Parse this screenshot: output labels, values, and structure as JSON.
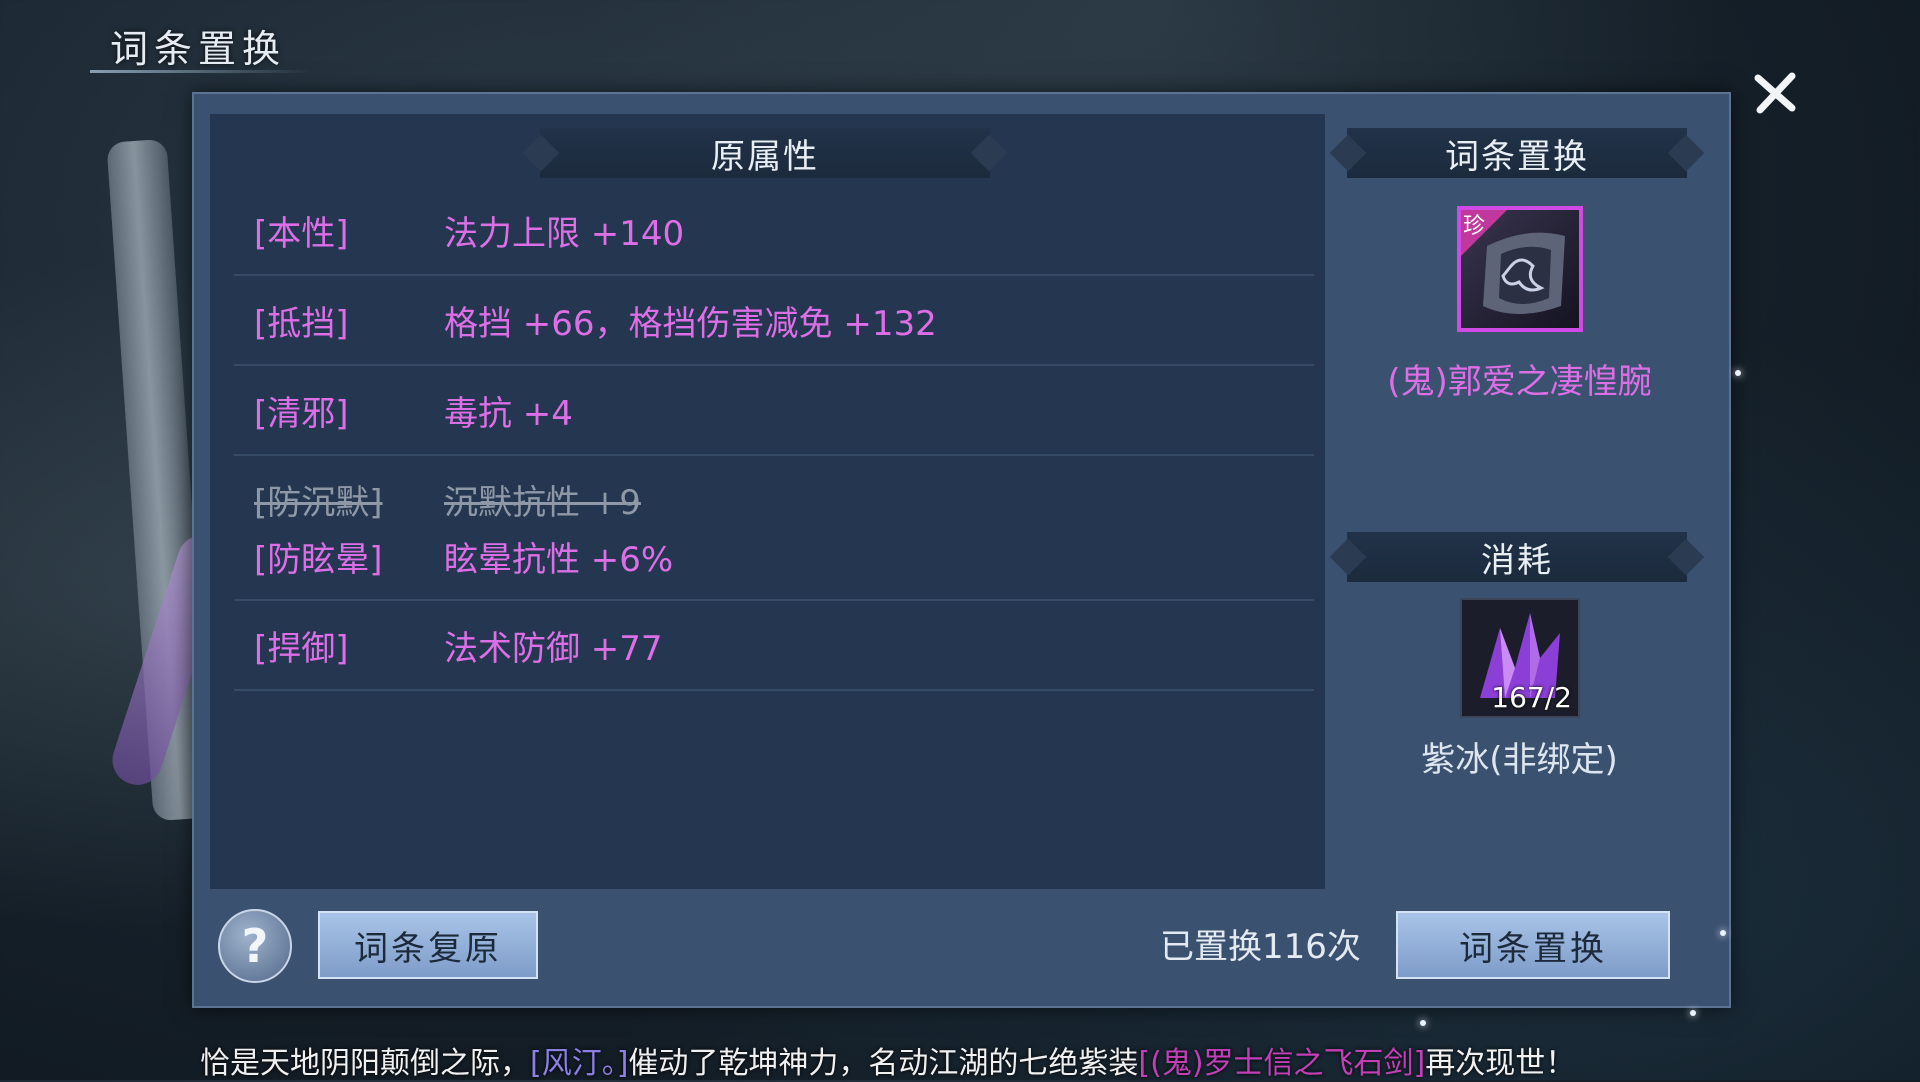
{
  "window": {
    "title": "词条置换",
    "close_icon": "close-icon"
  },
  "left_panel": {
    "header": "原属性",
    "rows": [
      {
        "tag": "[本性]",
        "value": "法力上限 +140",
        "struck": false
      },
      {
        "tag": "[抵挡]",
        "value": "格挡 +66，格挡伤害减免 +132",
        "struck": false
      },
      {
        "tag": "[清邪]",
        "value": "毒抗 +4",
        "struck": false
      },
      {
        "tag": "[防沉默]",
        "value": "沉默抗性 +9",
        "struck": true
      },
      {
        "tag": "[防眩晕]",
        "value": "眩晕抗性 +6%",
        "struck": false
      },
      {
        "tag": "[捍御]",
        "value": "法术防御 +77",
        "struck": false
      }
    ]
  },
  "right_panel": {
    "header": "词条置换",
    "item": {
      "badge": "珍",
      "name": "(鬼)郭爱之凄惶腕",
      "icon": "bracer-item-icon"
    },
    "cost_header": "消耗",
    "material": {
      "count": "167/2",
      "name": "紫冰(非绑定)",
      "icon": "purple-crystal-icon"
    }
  },
  "bottom": {
    "help_symbol": "?",
    "restore_button": "词条复原",
    "count_text": "已置换116次",
    "replace_button": "词条置换"
  },
  "ticker": {
    "part1": "恰是天地阴阳颠倒之际，",
    "player": "[风汀。]",
    "part2": "催动了乾坤神力，名动江湖的七绝紫装",
    "item": "[(鬼)罗士信之飞石剑]",
    "part3": "再次现世！"
  },
  "colors": {
    "attribute_text": "#dd6fe6",
    "struck_text": "#8f98a6",
    "panel_bg": "#243650",
    "button_bg": "#a9c4e8"
  }
}
